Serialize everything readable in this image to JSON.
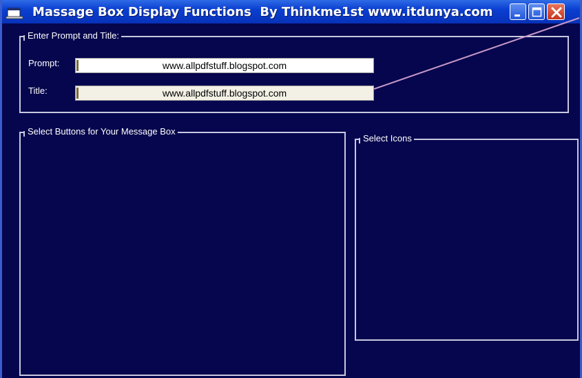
{
  "window": {
    "title": "Massage Box Display Functions  By Thinkme1st www.itdunya.com",
    "app_icon": "app-window-icon",
    "controls": {
      "minimize_icon": "minimize-icon",
      "maximize_icon": "maximize-icon",
      "close_icon": "close-icon"
    }
  },
  "prompt_group": {
    "legend": "Enter Prompt and Title:",
    "prompt_label": "Prompt:",
    "prompt_value": "www.allpdfstuff.blogspot.com",
    "title_label": "Title:",
    "title_value": "www.allpdfstuff.blogspot.com"
  },
  "buttons_group": {
    "legend": "Select Buttons for Your Message Box"
  },
  "icons_group": {
    "legend": "Select Icons"
  },
  "colors": {
    "window_background": "#06064e",
    "titlebar": "#0a3fd1",
    "group_border": "#c8c8e0",
    "annotation_line": "#c89ac8"
  }
}
